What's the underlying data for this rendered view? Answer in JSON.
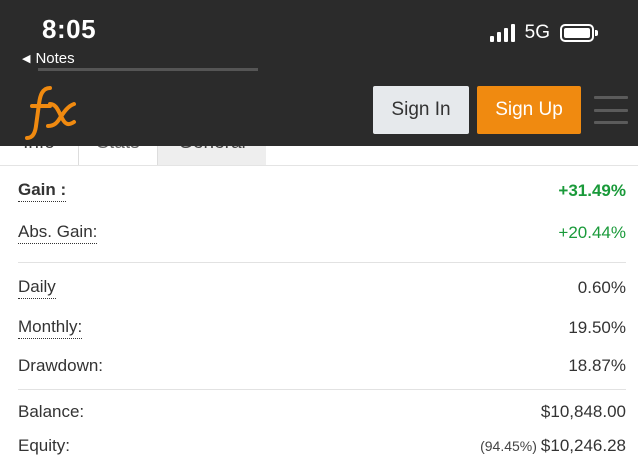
{
  "status_bar": {
    "time": "8:05",
    "back_label": "Notes",
    "network": "5G",
    "icons": [
      "signal-bars-icon",
      "battery-icon",
      "back-triangle-icon"
    ]
  },
  "header": {
    "logo_text": "fx",
    "sign_in": "Sign In",
    "sign_up": "Sign Up",
    "accent_color": "#f08a10",
    "menu_icon": "hamburger-menu-icon"
  },
  "tabs": [
    {
      "label": "Info"
    },
    {
      "label": "Stats"
    },
    {
      "label": "General"
    }
  ],
  "stats": {
    "gain": {
      "label": "Gain :",
      "value": "+31.49%"
    },
    "abs_gain": {
      "label": "Abs. Gain:",
      "value": "+20.44%"
    },
    "daily": {
      "label": "Daily",
      "value": "0.60%"
    },
    "monthly": {
      "label": "Monthly:",
      "value": "19.50%"
    },
    "drawdown": {
      "label": "Drawdown:",
      "value": "18.87%"
    },
    "balance": {
      "label": "Balance:",
      "value": "$10,848.00"
    },
    "equity": {
      "label": "Equity:",
      "percent": "(94.45%)",
      "value": "$10,246.28"
    }
  },
  "colors": {
    "positive": "#1a9a3a",
    "header_bg": "#2b2b2b"
  }
}
